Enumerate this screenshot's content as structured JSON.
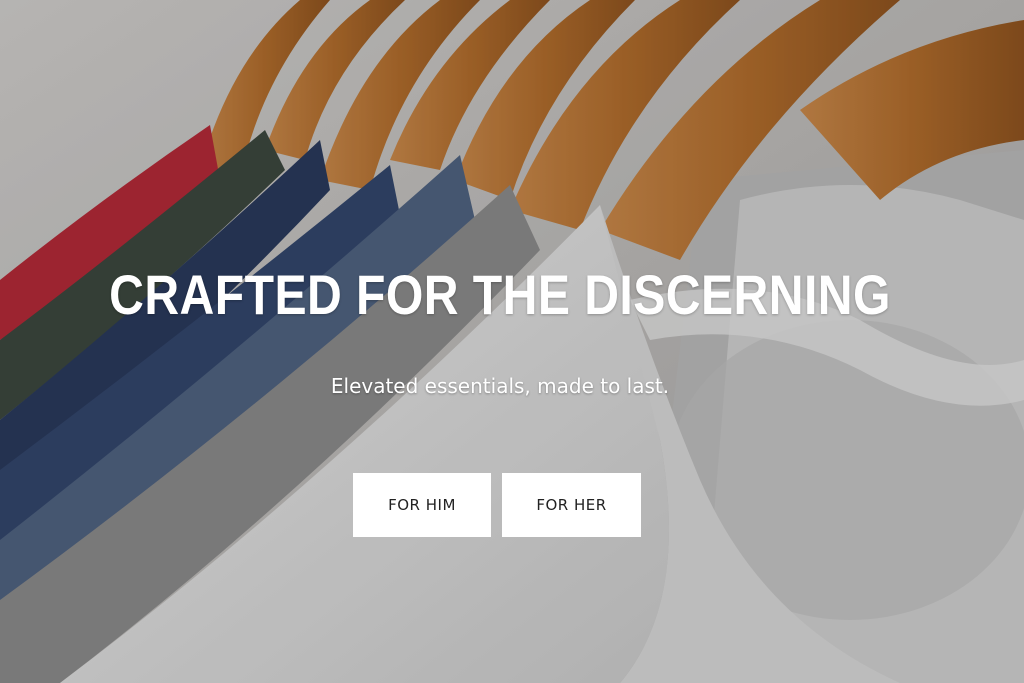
{
  "hero": {
    "image_subject": "t-shirts on wooden hangers",
    "headline": "CRAFTED FOR THE DISCERNING",
    "subheadline": "Elevated essentials, made to last."
  },
  "buttons": {
    "for_him": "FOR HIM",
    "for_her": "FOR HER"
  },
  "colors": {
    "headline_text": "#ffffff",
    "button_bg": "#ffffff",
    "button_text": "#222222",
    "hanger_wood": "#b5732e",
    "shirt_red": "#b22a37",
    "shirt_green": "#3c473e",
    "shirt_navy": "#2a3a5c",
    "shirt_blue_gray": "#4f6280",
    "shirt_gray": "#8a8a8a",
    "shirt_white": "#e6e6e6"
  }
}
